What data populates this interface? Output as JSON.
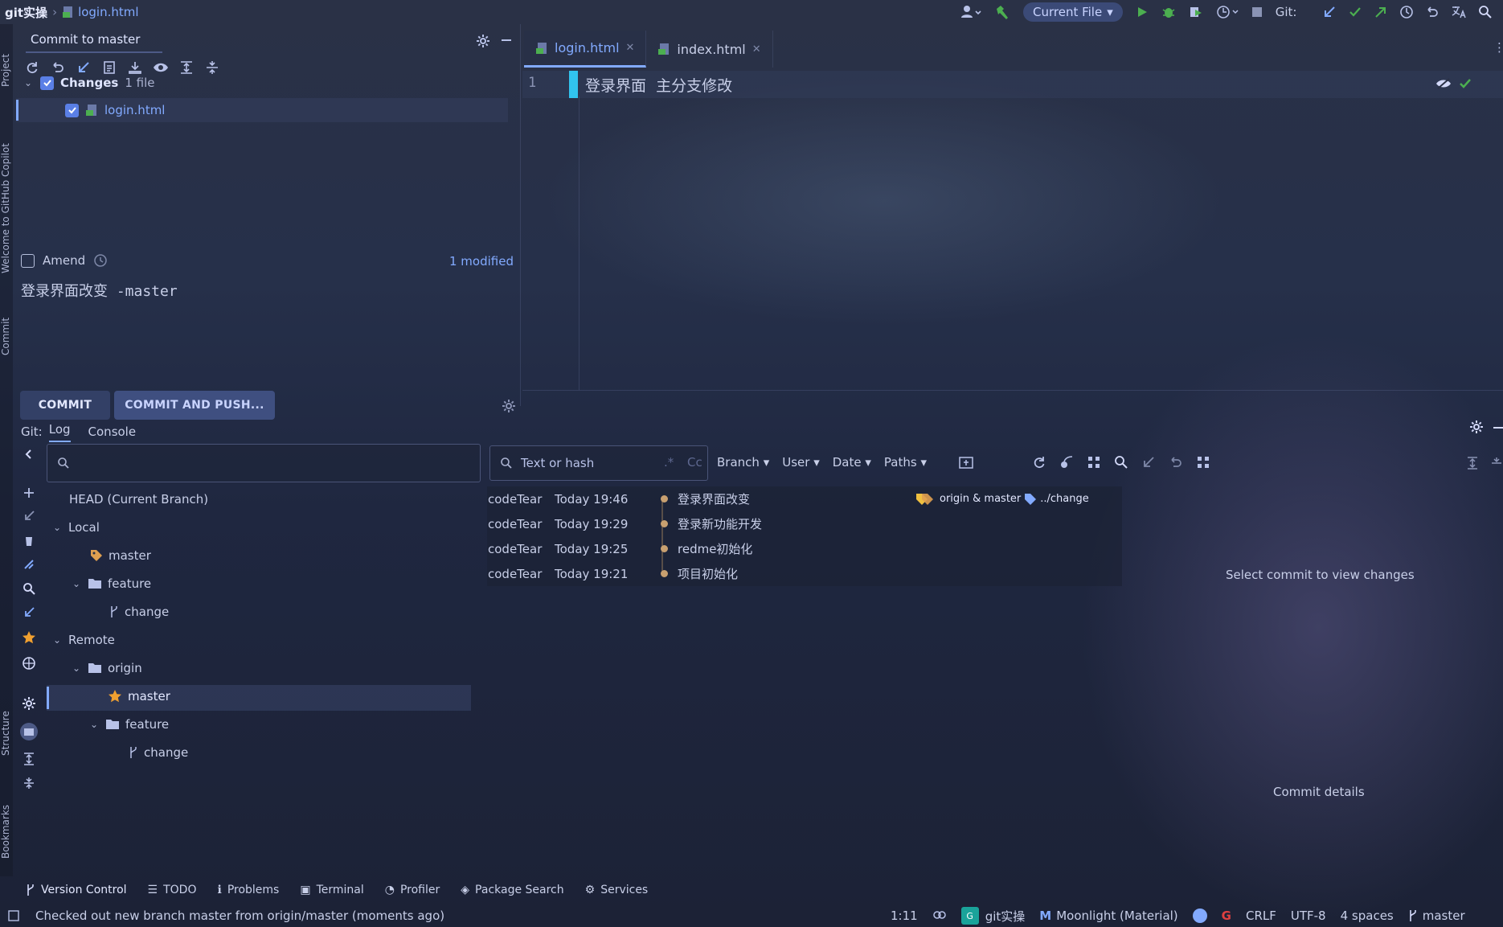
{
  "titlebar": {
    "project": "git实操",
    "file": "login.html",
    "run_config": "Current File",
    "git_label": "Git:"
  },
  "side_tabs": {
    "project": "Project",
    "copilot": "Welcome to GitHub Copilot",
    "commit": "Commit",
    "structure": "Structure",
    "bookmarks": "Bookmarks"
  },
  "commit_panel": {
    "title": "Commit to master",
    "changes_label": "Changes",
    "changes_count": "1 file",
    "file": "login.html",
    "amend_label": "Amend",
    "modified_label": "1 modified",
    "message": "登录界面改变 -master",
    "commit_button": "COMMIT",
    "commit_push_button": "COMMIT AND PUSH..."
  },
  "editor": {
    "tabs": [
      {
        "label": "login.html",
        "active": true
      },
      {
        "label": "index.html",
        "active": false
      }
    ],
    "line_number": "1",
    "line_text": "登录界面  主分支修改"
  },
  "git_window": {
    "label": "Git:",
    "tabs": [
      "Log",
      "Console"
    ],
    "search_placeholder": "",
    "filter_placeholder": "Text or hash",
    "filters": [
      "Branch",
      "User",
      "Date",
      "Paths"
    ],
    "branches": {
      "head": "HEAD (Current Branch)",
      "local": "Local",
      "local_master": "master",
      "local_feature": "feature",
      "local_change": "change",
      "remote": "Remote",
      "origin": "origin",
      "remote_master": "master",
      "remote_feature": "feature",
      "remote_change": "change"
    },
    "commits": [
      {
        "author": "codeTear",
        "date": "Today 19:46",
        "message": "登录界面改变",
        "refs": "origin & master",
        "refs2": "../change"
      },
      {
        "author": "codeTear",
        "date": "Today 19:29",
        "message": "登录新功能开发"
      },
      {
        "author": "codeTear",
        "date": "Today 19:25",
        "message": "redme初始化"
      },
      {
        "author": "codeTear",
        "date": "Today 19:21",
        "message": "项目初始化"
      }
    ],
    "select_hint": "Select commit to view changes",
    "details_label": "Commit details"
  },
  "tool_windows": [
    "Version Control",
    "TODO",
    "Problems",
    "Terminal",
    "Profiler",
    "Package Search",
    "Services"
  ],
  "statusbar": {
    "message": "Checked out new branch master from origin/master (moments ago)",
    "position": "1:11",
    "project": "git实操",
    "project_badge": "G",
    "theme": "Moonlight (Material)",
    "line_sep": "CRLF",
    "encoding": "UTF-8",
    "indent": "4 spaces",
    "branch": "master"
  },
  "colors": {
    "accent": "#82aaff",
    "checkbox": "#5a7fe6",
    "button_primary": "#3b4a77",
    "git_green": "#4caf50",
    "star": "#f0a030"
  }
}
